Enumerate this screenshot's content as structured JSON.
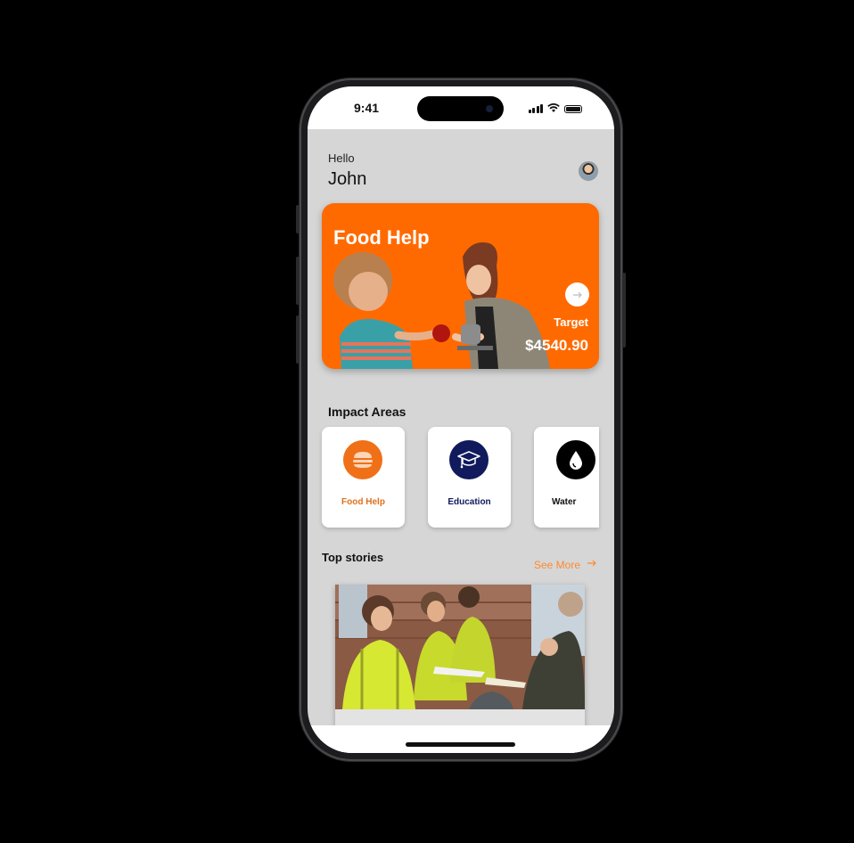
{
  "status": {
    "time": "9:41"
  },
  "greeting": {
    "hello": "Hello",
    "name": "John"
  },
  "hero": {
    "title": "Food Help",
    "target_label": "Target",
    "target_amount": "$4540.90",
    "accent": "#ff6a00"
  },
  "impact": {
    "title": "Impact Areas",
    "items": [
      {
        "label": "Food Help",
        "icon": "burger-icon",
        "color": "#f07018",
        "label_color": "#e0701a"
      },
      {
        "label": "Education",
        "icon": "graduation-cap-icon",
        "color": "#101a5c",
        "label_color": "#101a5c"
      },
      {
        "label": "Water",
        "icon": "water-drop-icon",
        "color": "#000000",
        "label_color": "#111111"
      }
    ]
  },
  "stories": {
    "title": "Top stories",
    "see_more": "See More",
    "see_more_icon": "arrow-right-icon"
  }
}
